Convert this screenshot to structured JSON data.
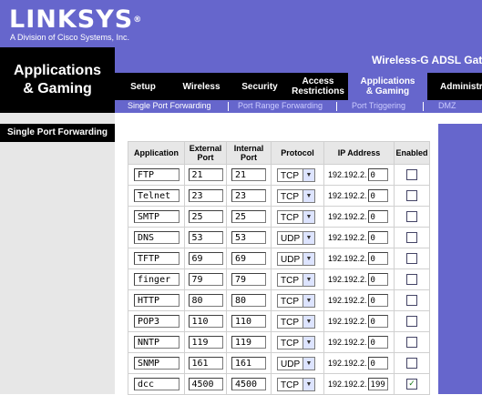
{
  "brand": {
    "logo": "LINKSYS",
    "reg": "®",
    "tagline": "A Division of Cisco Systems, Inc."
  },
  "product_name": "Wireless-G ADSL Gatewa",
  "section_title_line1": "Applications",
  "section_title_line2": "& Gaming",
  "tabs": [
    {
      "line1": "Setup",
      "line2": ""
    },
    {
      "line1": "Wireless",
      "line2": ""
    },
    {
      "line1": "Security",
      "line2": ""
    },
    {
      "line1": "Access",
      "line2": "Restrictions"
    },
    {
      "line1": "Applications",
      "line2": "& Gaming"
    },
    {
      "line1": "Administra",
      "line2": ""
    }
  ],
  "subtabs": [
    "Single Port Forwarding",
    "Port Range Forwarding",
    "Port Triggering",
    "DMZ"
  ],
  "sidebar_label": "Single Port Forwarding",
  "table": {
    "headers": {
      "application": "Application",
      "external_port_1": "External",
      "external_port_2": "Port",
      "internal_port_1": "Internal",
      "internal_port_2": "Port",
      "protocol": "Protocol",
      "ip_address": "IP Address",
      "enabled": "Enabled"
    },
    "ip_prefix": "192.192.2.",
    "rows": [
      {
        "app": "FTP",
        "ext": "21",
        "int": "21",
        "proto": "TCP",
        "ip": "0",
        "enabled": false
      },
      {
        "app": "Telnet",
        "ext": "23",
        "int": "23",
        "proto": "TCP",
        "ip": "0",
        "enabled": false
      },
      {
        "app": "SMTP",
        "ext": "25",
        "int": "25",
        "proto": "TCP",
        "ip": "0",
        "enabled": false
      },
      {
        "app": "DNS",
        "ext": "53",
        "int": "53",
        "proto": "UDP",
        "ip": "0",
        "enabled": false
      },
      {
        "app": "TFTP",
        "ext": "69",
        "int": "69",
        "proto": "UDP",
        "ip": "0",
        "enabled": false
      },
      {
        "app": "finger",
        "ext": "79",
        "int": "79",
        "proto": "TCP",
        "ip": "0",
        "enabled": false
      },
      {
        "app": "HTTP",
        "ext": "80",
        "int": "80",
        "proto": "TCP",
        "ip": "0",
        "enabled": false
      },
      {
        "app": "POP3",
        "ext": "110",
        "int": "110",
        "proto": "TCP",
        "ip": "0",
        "enabled": false
      },
      {
        "app": "NNTP",
        "ext": "119",
        "int": "119",
        "proto": "TCP",
        "ip": "0",
        "enabled": false
      },
      {
        "app": "SNMP",
        "ext": "161",
        "int": "161",
        "proto": "UDP",
        "ip": "0",
        "enabled": false
      },
      {
        "app": "dcc",
        "ext": "4500",
        "int": "4500",
        "proto": "TCP",
        "ip": "199",
        "enabled": true
      }
    ]
  },
  "colors": {
    "purple": "#6666cc",
    "black": "#000000",
    "grey": "#e7e7e7"
  }
}
